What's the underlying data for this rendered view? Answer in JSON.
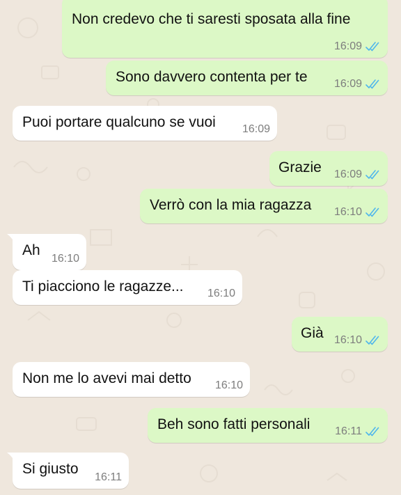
{
  "messages": [
    {
      "direction": "out",
      "text": "Non credevo che ti saresti sposata alla fine",
      "time": "16:09",
      "status": "read"
    },
    {
      "direction": "out",
      "text": "Sono davvero contenta per te",
      "time": "16:09",
      "status": "read"
    },
    {
      "direction": "in",
      "text": "Puoi portare qualcuno se vuoi",
      "time": "16:09"
    },
    {
      "direction": "out",
      "text": "Grazie",
      "time": "16:09",
      "status": "read"
    },
    {
      "direction": "out",
      "text": "Verrò con la mia ragazza",
      "time": "16:10",
      "status": "read"
    },
    {
      "direction": "in",
      "text": "Ah",
      "time": "16:10"
    },
    {
      "direction": "in",
      "text": "Ti piacciono le ragazze...",
      "time": "16:10"
    },
    {
      "direction": "out",
      "text": "Già",
      "time": "16:10",
      "status": "read"
    },
    {
      "direction": "in",
      "text": "Non me lo avevi mai detto",
      "time": "16:10"
    },
    {
      "direction": "out",
      "text": "Beh sono fatti personali",
      "time": "16:11",
      "status": "read"
    },
    {
      "direction": "in",
      "text": "Si giusto",
      "time": "16:11"
    }
  ],
  "colors": {
    "background": "#efe7dd",
    "outgoing_bubble": "#dcf8c6",
    "incoming_bubble": "#ffffff",
    "read_ticks": "#4fb6ec",
    "timestamp": "#7d7d7d"
  },
  "icons": {
    "read_status": "double-check-icon"
  }
}
